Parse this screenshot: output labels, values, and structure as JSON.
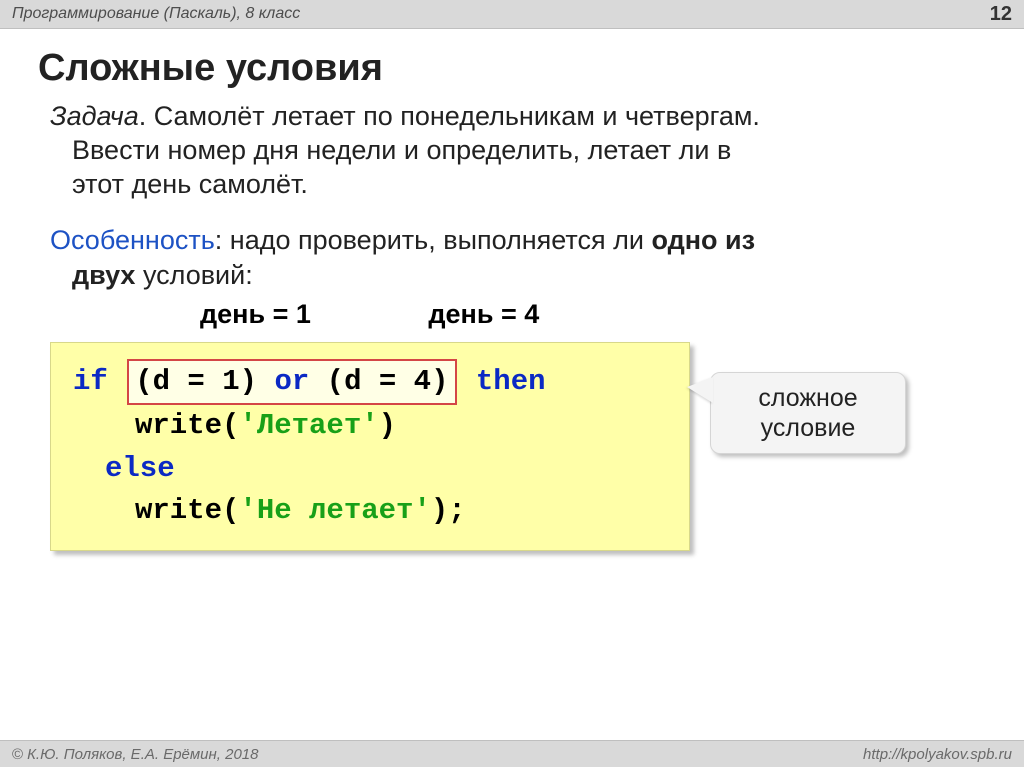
{
  "header": {
    "title": "Программирование (Паскаль), 8 класс",
    "page_number": "12"
  },
  "title": "Сложные условия",
  "task": {
    "label": "Задача",
    "line1": ". Самолёт летает по понедельникам и четвергам.",
    "line2": "Ввести номер дня недели и определить, летает ли в",
    "line3": "этот день самолёт."
  },
  "feature": {
    "label": "Особенность",
    "rest1": ": надо проверить, выполняется ли ",
    "bold1": "одно из",
    "bold2": "двух",
    "rest2": " условий:"
  },
  "conditions": {
    "c1": "день = 1",
    "c2": "день = 4"
  },
  "code": {
    "if_kw": "if",
    "cond_l": "(d = 1) ",
    "or_kw": "or",
    "cond_r": " (d = 4)",
    "then_kw": "then",
    "write1_a": "write(",
    "write1_str": "'Летает'",
    "write1_b": ")",
    "else_kw": "else",
    "write2_a": "write(",
    "write2_str": "'Не летает'",
    "write2_b": ");"
  },
  "callout": {
    "line1": "сложное",
    "line2": "условие"
  },
  "footer": {
    "copyright": "К.Ю. Поляков, Е.А. Ерёмин, 2018",
    "url": "http://kpolyakov.spb.ru"
  }
}
